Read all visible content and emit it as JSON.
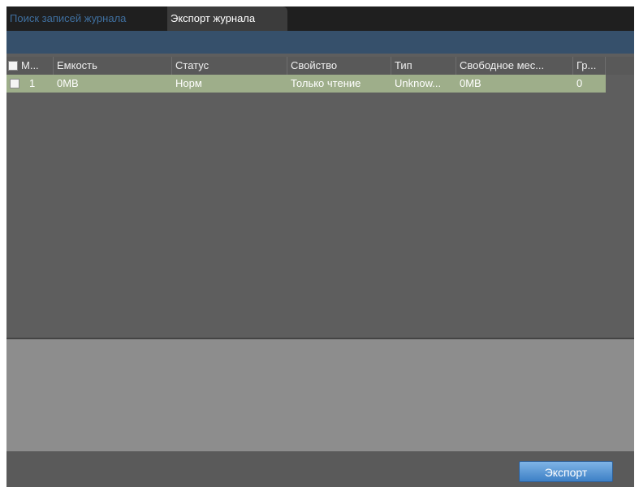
{
  "tabs": [
    {
      "label": "Поиск записей журнала",
      "active": false
    },
    {
      "label": "Экспорт журнала",
      "active": true
    }
  ],
  "table": {
    "columns": [
      "М...",
      "Емкость",
      "Статус",
      "Свойство",
      "Тип",
      "Свободное мес...",
      "Гр..."
    ],
    "rows": [
      {
        "num": "1",
        "capacity": "0MB",
        "status": "Норм",
        "property": "Только чтение",
        "type": "Unknow...",
        "free_space": "0MB",
        "group": "0",
        "checked": false
      }
    ]
  },
  "footer": {
    "export_label": "Экспорт"
  },
  "colors": {
    "tab_inactive": "#3f6f9f",
    "selected_row": "#9eae8a",
    "button_accent": "#3d80c6"
  }
}
